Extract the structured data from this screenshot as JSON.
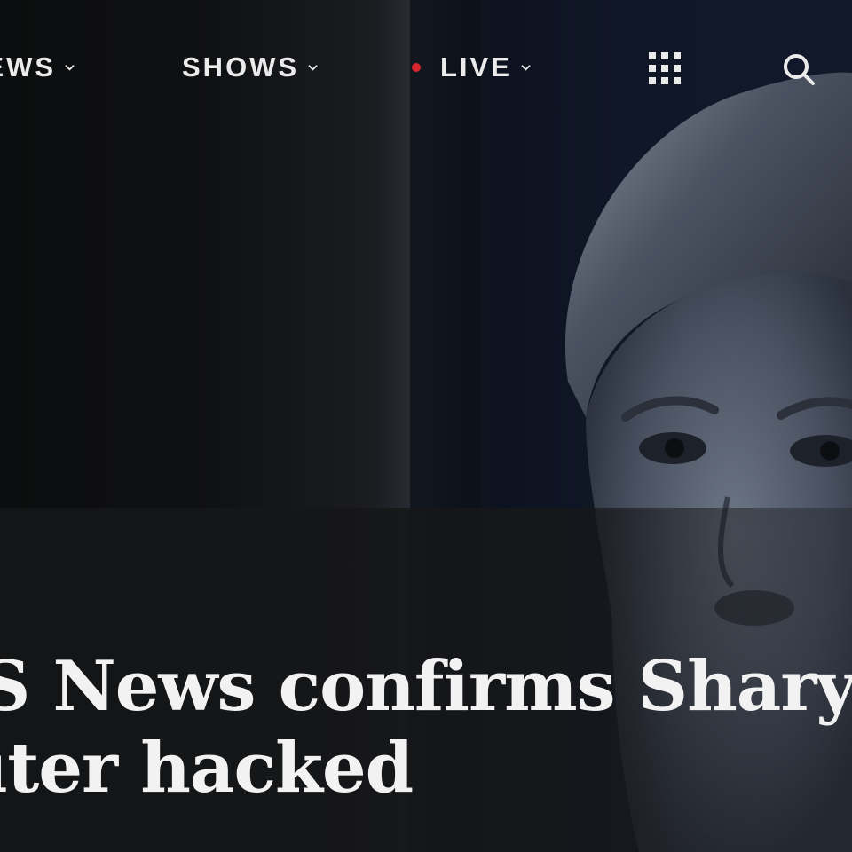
{
  "nav": {
    "items": [
      {
        "label": "NEWS",
        "has_dropdown": true
      },
      {
        "label": "SHOWS",
        "has_dropdown": true
      },
      {
        "label": "LIVE",
        "has_dropdown": true,
        "live_indicator": true
      }
    ],
    "apps_icon": "grid-icon",
    "search_icon": "search-icon"
  },
  "article": {
    "headline_line1": "CBS News confirms Sharyl Attkisson's",
    "headline_line2": "computer hacked"
  },
  "colors": {
    "background": "#121314",
    "text": "#ebebeb",
    "live_dot": "#d8262b"
  }
}
